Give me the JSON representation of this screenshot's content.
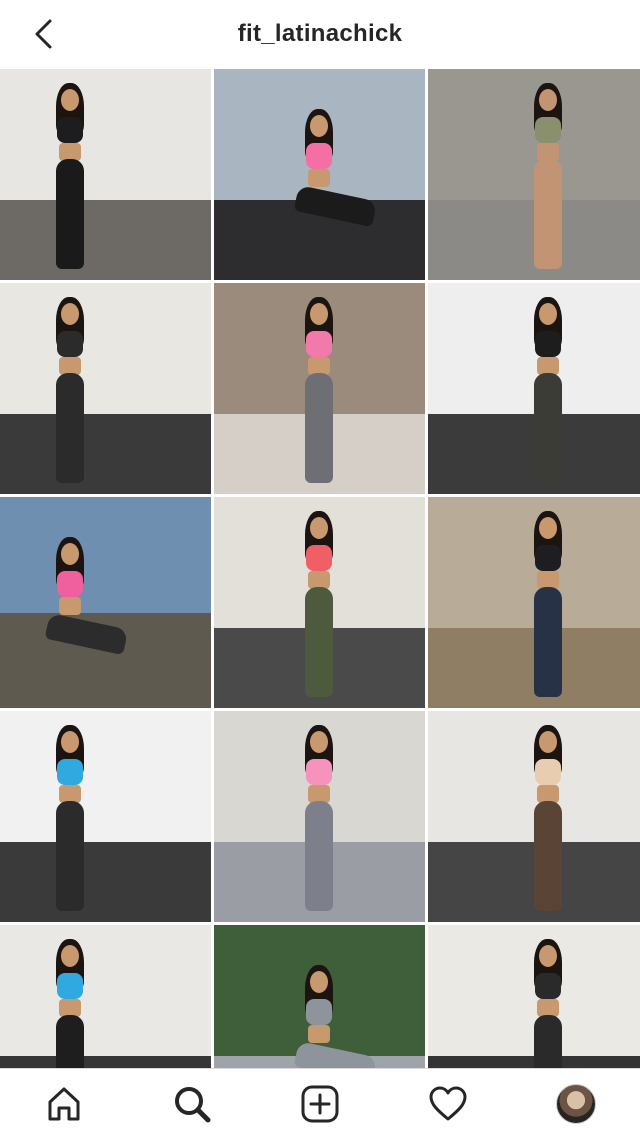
{
  "header": {
    "title": "fit_latinachick",
    "back_icon": "chevron-left-icon"
  },
  "grid": {
    "tiles": [
      {
        "name": "post-1",
        "bg": "#e8e6e2",
        "floor": "#6d6a66",
        "top": "#1d1d1f",
        "legs": "#1a1a1a",
        "skin": "#c8996f"
      },
      {
        "name": "post-2",
        "bg": "#a9b6c2",
        "floor": "#2d2d2f",
        "top": "#f46fa4",
        "legs": "#1b1b1b",
        "skin": "#c8996f"
      },
      {
        "name": "post-3",
        "bg": "#9a9791",
        "floor": "#8c8a86",
        "top": "#8a8f6d",
        "legs": "#c39474",
        "skin": "#c39474"
      },
      {
        "name": "post-4",
        "bg": "#e9e7e1",
        "floor": "#3a3a3a",
        "top": "#2b2b2b",
        "legs": "#2b2b2b",
        "skin": "#c8996f"
      },
      {
        "name": "post-5",
        "bg": "#9a8b7c",
        "floor": "#d5cfc7",
        "top": "#f27aaa",
        "legs": "#6d6f74",
        "skin": "#c8996f"
      },
      {
        "name": "post-6",
        "bg": "#eeeeee",
        "floor": "#3b3b3b",
        "top": "#1d1d1d",
        "legs": "#3a3c35",
        "skin": "#c8996f"
      },
      {
        "name": "post-7",
        "bg": "#6f8fb0",
        "floor": "#5e5a50",
        "top": "#f05f9e",
        "legs": "#2c2c2c",
        "skin": "#c8996f"
      },
      {
        "name": "post-8",
        "bg": "#e3e0d9",
        "floor": "#4a4a4a",
        "top": "#f05f66",
        "legs": "#4d5a3e",
        "skin": "#c8996f"
      },
      {
        "name": "post-9",
        "bg": "#b8ab98",
        "floor": "#8f7e64",
        "top": "#1e1e22",
        "legs": "#273246",
        "skin": "#c8996f"
      },
      {
        "name": "post-10",
        "bg": "#f1f1f1",
        "floor": "#3a3a3a",
        "top": "#2fa9e0",
        "legs": "#2b2b2b",
        "skin": "#c8996f"
      },
      {
        "name": "post-11",
        "bg": "#d9d7d2",
        "floor": "#9a9da3",
        "top": "#f593bd",
        "legs": "#7d808a",
        "skin": "#c8996f"
      },
      {
        "name": "post-12",
        "bg": "#e8e6e2",
        "floor": "#454545",
        "top": "#e8cdb1",
        "legs": "#5a4436",
        "skin": "#c8996f"
      },
      {
        "name": "post-13",
        "bg": "#eae8e4",
        "floor": "#363636",
        "top": "#2fa9e0",
        "legs": "#1e1e1e",
        "skin": "#c8996f"
      },
      {
        "name": "post-14",
        "bg": "#3f5f3a",
        "floor": "#9ea4aa",
        "top": "#8d949b",
        "legs": "#8d949b",
        "skin": "#c8996f"
      },
      {
        "name": "post-15",
        "bg": "#ebe9e4",
        "floor": "#343434",
        "top": "#2a2a2a",
        "legs": "#2a2a2a",
        "skin": "#c8996f"
      }
    ]
  },
  "tabbar": {
    "items": [
      {
        "name": "home-tab",
        "icon": "home-icon"
      },
      {
        "name": "search-tab",
        "icon": "search-icon"
      },
      {
        "name": "new-post-tab",
        "icon": "plus-square-icon"
      },
      {
        "name": "activity-tab",
        "icon": "heart-icon"
      },
      {
        "name": "profile-tab",
        "icon": "avatar"
      }
    ]
  }
}
